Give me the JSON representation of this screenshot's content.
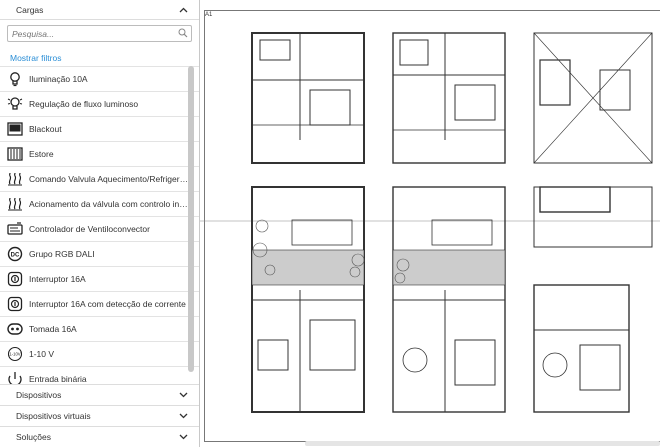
{
  "sidebar": {
    "title": "Cargas",
    "search_placeholder": "Pesquisa...",
    "filters_link": "Mostrar filtros",
    "items": [
      {
        "label": "Iluminação 10A",
        "icon": "bulb-icon"
      },
      {
        "label": "Regulação de fluxo luminoso",
        "icon": "dimmer-bulb-icon"
      },
      {
        "label": "Blackout",
        "icon": "blackout-blind-icon"
      },
      {
        "label": "Estore",
        "icon": "shutter-icon"
      },
      {
        "label": "Comando Valvula Aquecimento/Refrigeração",
        "icon": "heating-valve-icon"
      },
      {
        "label": "Acionamento da válvula com controlo integrado",
        "icon": "valve-control-icon"
      },
      {
        "label": "Controlador de Ventiloconvector",
        "icon": "fan-coil-icon"
      },
      {
        "label": "Grupo RGB DALI",
        "icon": "dali-icon"
      },
      {
        "label": "Interruptor 16A",
        "icon": "switch-icon"
      },
      {
        "label": "Interruptor 16A com detecção de corrente",
        "icon": "switch-current-icon"
      },
      {
        "label": "Tomada 16A",
        "icon": "socket-icon"
      },
      {
        "label": "1-10 V",
        "icon": "one-ten-volt-icon"
      },
      {
        "label": "Entrada binária",
        "icon": "binary-input-icon"
      }
    ],
    "one_ten_badge": "1-10V"
  },
  "footer": {
    "sections": [
      "Dispositivos",
      "Dispositivos virtuais",
      "Soluções"
    ]
  },
  "canvas": {
    "sheet_label": "A1"
  }
}
